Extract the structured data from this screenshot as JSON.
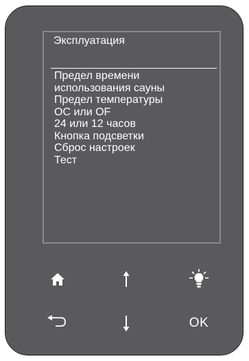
{
  "screen": {
    "title": "Эксплуатация",
    "items": [
      {
        "label": "Предел времени"
      },
      {
        "label": "использования сауны"
      },
      {
        "label": "Предел температуры"
      },
      {
        "label": "OC или OF"
      },
      {
        "label": "24 или 12 часов"
      },
      {
        "label": "Кнопка подсветки"
      },
      {
        "label": "Сброс настроек"
      },
      {
        "label": "Тест"
      }
    ]
  },
  "buttons": {
    "home_icon": "home-icon",
    "up_icon": "arrow-up-icon",
    "light_icon": "light-bulb-icon",
    "back_icon": "back-arrow-icon",
    "down_icon": "arrow-down-icon",
    "ok_label": "OK"
  },
  "colors": {
    "panel": "#5a5a5c",
    "border": "#1e1e1e",
    "screen_frame": "#8a8a8c",
    "text": "#ffffff"
  }
}
